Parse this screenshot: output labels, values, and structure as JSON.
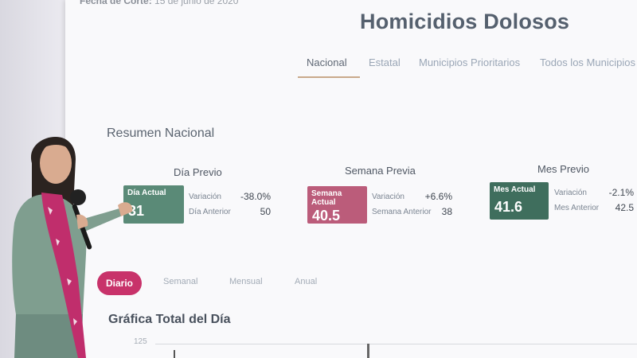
{
  "header": {
    "cutoff_label": "Fecha de Corte:",
    "cutoff_date": "15 de junio de 2020",
    "title": "Homicidios Dolosos"
  },
  "tabs": [
    {
      "label": "Nacional",
      "active": true
    },
    {
      "label": "Estatal",
      "active": false
    },
    {
      "label": "Municipios Prioritarios",
      "active": false
    },
    {
      "label": "Todos los Municipios",
      "active": false
    }
  ],
  "summary": {
    "heading": "Resumen Nacional",
    "sections": [
      {
        "title": "Día Previo",
        "card_label": "Día Actual",
        "value": "31",
        "var_label": "Variación",
        "var_value": "-38.0%",
        "prev_label": "Día Anterior",
        "prev_value": "50",
        "color": "#5a8a77"
      },
      {
        "title": "Semana Previa",
        "card_label": "Semana Actual",
        "value": "40.5",
        "var_label": "Variación",
        "var_value": "+6.6%",
        "prev_label": "Semana Anterior",
        "prev_value": "38",
        "color": "#bb5c7a"
      },
      {
        "title": "Mes Previo",
        "card_label": "Mes Actual",
        "value": "41.6",
        "var_label": "Variación",
        "var_value": "-2.1%",
        "prev_label": "Mes Anterior",
        "prev_value": "42.5",
        "color": "#3f6e5d"
      }
    ]
  },
  "periods": [
    {
      "label": "Diario",
      "active": true
    },
    {
      "label": "Semanal",
      "active": false
    },
    {
      "label": "Mensual",
      "active": false
    },
    {
      "label": "Anual",
      "active": false
    }
  ],
  "graph": {
    "title": "Gráfica Total del Día",
    "y_tick": "125"
  },
  "colors": {
    "accent": "#c8326a",
    "title": "#55606e"
  }
}
